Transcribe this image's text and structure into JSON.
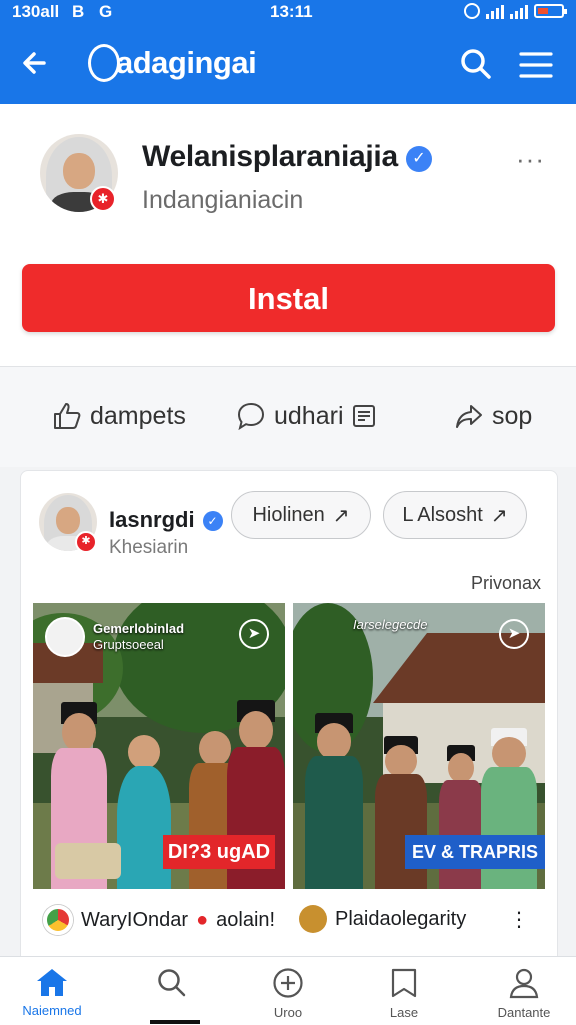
{
  "status_bar": {
    "left": "130all",
    "left_icons": [
      "B",
      "G"
    ],
    "time": "13:11"
  },
  "app_bar": {
    "title": "adagingai",
    "icons": [
      "back-arrow-icon",
      "search-icon",
      "hamburger-menu-icon"
    ]
  },
  "profile": {
    "name": "Welanisplaraniajia",
    "subtitle": "Indangianiacin",
    "verified": true,
    "more": "···",
    "install_label": "Instal",
    "install_color": "#ef2b2b"
  },
  "actions": {
    "like_label": "dampets",
    "comment_label": "udhari",
    "share_label": "sop"
  },
  "post": {
    "author": "Iasnrgdi",
    "author_sub": "Khesiarin",
    "chip1": "Hiolinen",
    "chip2": "L Alsosht",
    "privacy": "Privonax",
    "tiles": [
      {
        "overlay_title": "Gemerlobinlad",
        "overlay_sub": "Gruptsoeeal",
        "banner": "DI?3 ugAD",
        "banner_color": "#e3262a",
        "caption": "WaryIOndar",
        "caption_extra": "aolain!"
      },
      {
        "overlay_title": "Iarselegecde",
        "overlay_sub": "",
        "banner": "EV & TRAPRIS",
        "banner_color": "#1f5fc9",
        "caption": "Plaidaolegarity",
        "caption_extra": "⋮"
      }
    ]
  },
  "bottom_nav": [
    {
      "label": "Naiemned",
      "icon": "home-icon",
      "active": true
    },
    {
      "label": "",
      "icon": "search-icon",
      "active": false
    },
    {
      "label": "Uroo",
      "icon": "plus-circle-icon",
      "active": false
    },
    {
      "label": "Lase",
      "icon": "bookmark-icon",
      "active": false
    },
    {
      "label": "Dantante",
      "icon": "profile-icon",
      "active": false
    }
  ],
  "colors": {
    "brand_blue": "#1976e8",
    "verified_blue": "#3b82f6",
    "install_red": "#ef2b2b"
  }
}
